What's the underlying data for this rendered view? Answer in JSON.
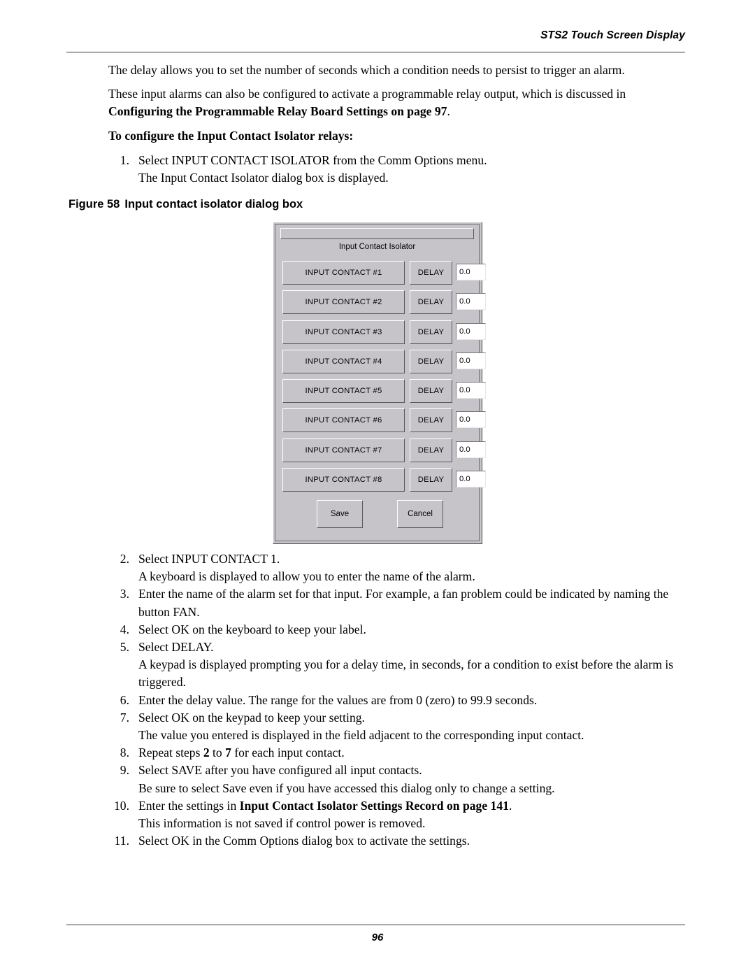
{
  "header": {
    "title": "STS2 Touch Screen Display"
  },
  "footer": {
    "page_number": "96"
  },
  "body": {
    "para1": "The delay allows you to set the number of seconds which a condition needs to persist to trigger an alarm.",
    "para2_prefix": "These input alarms can also be configured to activate a programmable relay output, which is discussed in ",
    "para2_bold": "Configuring the Programmable Relay Board Settings on page 97",
    "para2_suffix": ".",
    "heading": "To configure the Input Contact Isolator relays:",
    "step1": "Select INPUT CONTACT ISOLATOR from the Comm Options menu.",
    "step1_sub": "The Input Contact Isolator dialog box is displayed.",
    "step2": "Select INPUT CONTACT 1.",
    "step2_sub": "A keyboard is displayed to allow you to enter the name of the alarm.",
    "step3": "Enter the name of the alarm set for that input. For example, a fan problem could be indicated by naming the button FAN.",
    "step4": "Select OK on the keyboard to keep your label.",
    "step5": "Select DELAY.",
    "step5_sub": "A keypad is displayed prompting you for a delay time, in seconds, for a condition to exist before the alarm is triggered.",
    "step6": "Enter the delay value. The range for the values are from 0 (zero) to 99.9 seconds.",
    "step7": "Select OK on the keypad to keep your setting.",
    "step7_sub": "The value you entered is displayed in the field adjacent to the corresponding input contact.",
    "step8_prefix": "Repeat steps ",
    "step8_b1": "2",
    "step8_mid": " to ",
    "step8_b2": "7",
    "step8_suffix": " for each input contact.",
    "step9": "Select SAVE after you have configured all input contacts.",
    "step9_sub": "Be sure to select Save even if you have accessed this dialog only to change a setting.",
    "step10_prefix": "Enter the settings in ",
    "step10_bold": "Input Contact Isolator Settings Record on page 141",
    "step10_suffix": ".",
    "step10_sub": "This information is not saved if control power is removed.",
    "step11": "Select OK in the Comm Options dialog box to activate the settings.",
    "numbers": {
      "n1": "1.",
      "n2": "2.",
      "n3": "3.",
      "n4": "4.",
      "n5": "5.",
      "n6": "6.",
      "n7": "7.",
      "n8": "8.",
      "n9": "9.",
      "n10": "10.",
      "n11": "11."
    }
  },
  "figure": {
    "label": "Figure 58",
    "caption": "Input contact isolator dialog box"
  },
  "dialog": {
    "title": "Input Contact Isolator",
    "delay_label": "DELAY",
    "save_label": "Save",
    "cancel_label": "Cancel",
    "rows": [
      {
        "contact": "INPUT CONTACT #1",
        "delay": "DELAY",
        "value": "0.0"
      },
      {
        "contact": "INPUT CONTACT #2",
        "delay": "DELAY",
        "value": "0.0"
      },
      {
        "contact": "INPUT CONTACT #3",
        "delay": "DELAY",
        "value": "0.0"
      },
      {
        "contact": "INPUT CONTACT #4",
        "delay": "DELAY",
        "value": "0.0"
      },
      {
        "contact": "INPUT CONTACT #5",
        "delay": "DELAY",
        "value": "0.0"
      },
      {
        "contact": "INPUT CONTACT #6",
        "delay": "DELAY",
        "value": "0.0"
      },
      {
        "contact": "INPUT CONTACT #7",
        "delay": "DELAY",
        "value": "0.0"
      },
      {
        "contact": "INPUT CONTACT #8",
        "delay": "DELAY",
        "value": "0.0"
      }
    ],
    "colors": {
      "face": "#c6c4c9",
      "field": "#ffffff",
      "shadow": "#5a585d",
      "highlight": "#ffffff"
    }
  }
}
